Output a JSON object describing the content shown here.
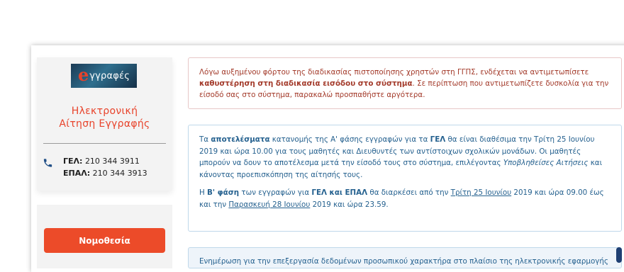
{
  "sidebar": {
    "logo": {
      "icon": "eggrafes-logo",
      "letter": "e",
      "word": "γγραφές"
    },
    "title_line1": "Ηλεκτρονική",
    "title_line2": "Αίτηση Εγγραφής",
    "phones": [
      {
        "label": "ΓΕΛ:",
        "number": "210 344 3911"
      },
      {
        "label": "ΕΠΑΛ:",
        "number": "210 344 3913"
      }
    ],
    "phone_icon": "phone-icon",
    "law_button": "Νομοθεσία"
  },
  "alerts": {
    "danger": {
      "part1": "Λόγω αυξημένου φόρτου της διαδικασίας πιστοποίησης χρηστών στη ΓΓΠΣ, ενδέχεται να αντιμετωπίσετε ",
      "bold": "καθυστέρηση στη διαδικασία εισόδου στο σύστημα",
      "part2": ". Σε περίπτωση που αντιμετωπίζετε δυσκολία για την είσοδό σας στο σύστημα, παρακαλώ προσπαθήστε αργότερα."
    },
    "info": {
      "p1_a": "Τα ",
      "p1_bold1": "αποτελέσματα",
      "p1_b": " κατανομής της Α' φάσης εγγραφών για τα ",
      "p1_bold2": "ΓΕΛ",
      "p1_c": " θα είναι διαθέσιμα την Τρίτη 25 Ιουνίου 2019 και ώρα 10.00 για τους μαθητές και Διευθυντές των αντίστοιχων σχολικών μονάδων. Οι μαθητές μπορούν να δουν το αποτέλεσμα μετά την είσοδό τους στο σύστημα, επιλέγοντας ",
      "p1_italic": "Υποβληθείσες Αιτήσεις",
      "p1_d": " και κάνοντας προεπισκόπηση της αίτησής τους.",
      "p2_a": "Η ",
      "p2_bold1": "Β' φάση",
      "p2_b": " των εγγραφών για ",
      "p2_bold2": "ΓΕΛ και ΕΠΑΛ",
      "p2_c": " θα διαρκέσει από την ",
      "p2_u1": "Τρίτη 25 Ιουνίου",
      "p2_d": " 2019 και ώρα 09.00 έως και την ",
      "p2_u2": "Παρασκευή 28 Ιουνίου",
      "p2_e": " 2019 και ώρα 23.59."
    },
    "bottom": {
      "text": "Ενημέρωση για την επεξεργασία δεδομένων προσωπικού χαρακτήρα στο πλαίσιο της ηλεκτρονικής εφαρμογής"
    }
  },
  "colors": {
    "accent": "#ec4b29",
    "danger_text": "#a33a2a",
    "info_text": "#25618f",
    "sidebar_bg": "#f3f3f3"
  }
}
